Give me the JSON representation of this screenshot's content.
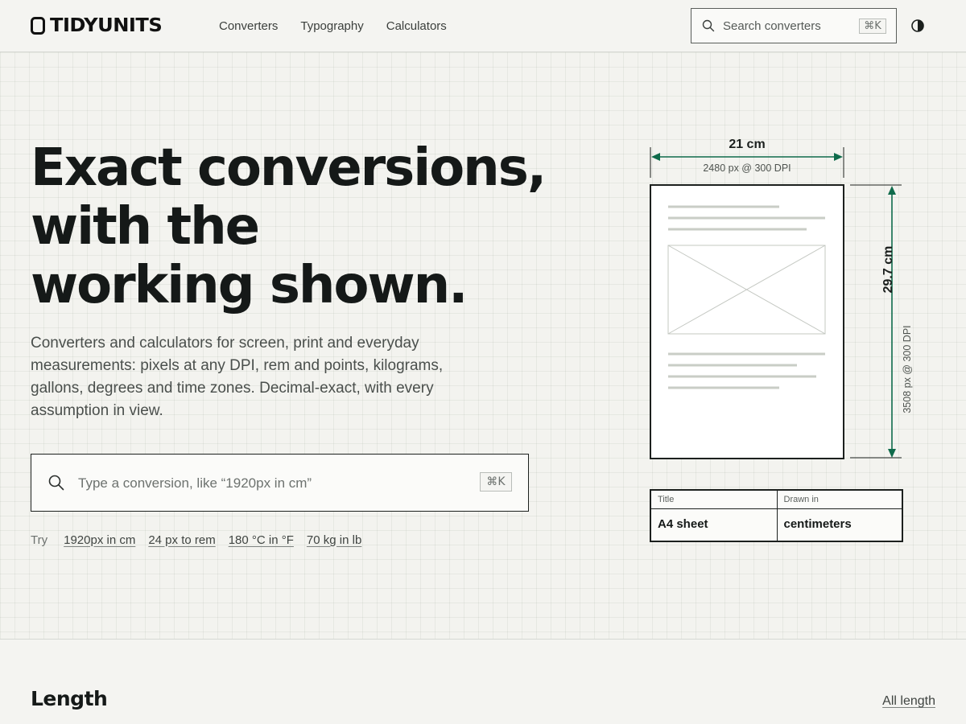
{
  "brand": {
    "name_part1": "TIDY",
    "name_part2": "UNITS",
    "accent_color": "#0f6b4b"
  },
  "nav": {
    "items": [
      {
        "label": "Converters"
      },
      {
        "label": "Typography"
      },
      {
        "label": "Calculators"
      }
    ]
  },
  "header_search": {
    "placeholder": "Search converters",
    "shortcut": "⌘K",
    "icon": "search-icon"
  },
  "theme_toggle": {
    "icon": "contrast-icon"
  },
  "hero": {
    "title_lines": [
      "Exact conversions,",
      "with the",
      "working shown."
    ],
    "description": "Converters and calculators for screen, print and everyday measurements: pixels at any DPI, rem and points, kilograms, gallons, degrees and time zones. Decimal-exact, with every assumption in view.",
    "search": {
      "placeholder": "Type a conversion, like “1920px in cm”",
      "shortcut": "⌘K"
    },
    "try_label": "Try",
    "examples": [
      {
        "label": "1920px in cm"
      },
      {
        "label": "24 px to rem"
      },
      {
        "label": "180 °C in °F"
      },
      {
        "label": "70 kg in lb"
      }
    ]
  },
  "drawing": {
    "width_label": "21 cm",
    "width_sub": "2480 px @ 300 DPI",
    "height_label": "29.7 cm",
    "height_sub": "3508 px @ 300 DPI",
    "dimension_color": "#0f6b4b",
    "title_block": {
      "title_label": "Title",
      "title_value": "A4 sheet",
      "unit_label": "Drawn in",
      "unit_value": "centimeters"
    }
  },
  "sections": {
    "length": {
      "title": "Length",
      "link": "All length"
    }
  }
}
